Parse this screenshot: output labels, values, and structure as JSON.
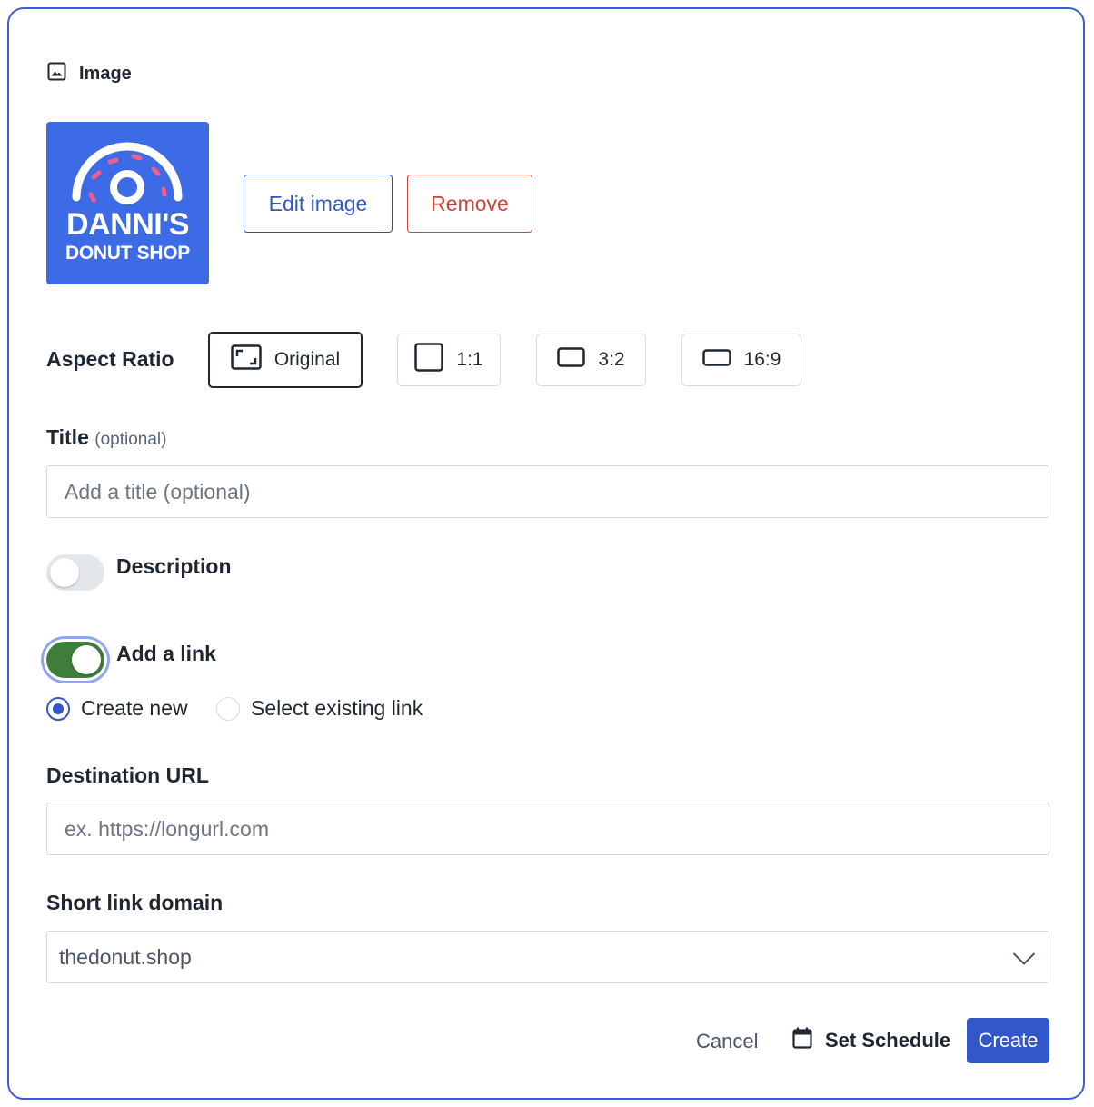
{
  "image_section": {
    "header_label": "Image",
    "header_icon": "image-icon",
    "thumbnail": {
      "logo_line1": "DANNI'S",
      "logo_line2": "DONUT SHOP",
      "bg_color": "#3d6be6"
    },
    "edit_label": "Edit image",
    "remove_label": "Remove"
  },
  "aspect_ratio": {
    "label": "Aspect Ratio",
    "options": [
      {
        "label": "Original",
        "icon": "crop-original-icon",
        "selected": true
      },
      {
        "label": "1:1",
        "icon": "square-icon",
        "selected": false
      },
      {
        "label": "3:2",
        "icon": "rectangle-icon",
        "selected": false
      },
      {
        "label": "16:9",
        "icon": "wide-rectangle-icon",
        "selected": false
      }
    ]
  },
  "title_field": {
    "label": "Title",
    "optional_label": "(optional)",
    "placeholder": "Add a title (optional)",
    "value": ""
  },
  "description_toggle": {
    "label": "Description",
    "on": false
  },
  "link_toggle": {
    "label": "Add a link",
    "on": true,
    "on_color": "#3f7d3a"
  },
  "link_mode": {
    "options": [
      {
        "label": "Create new",
        "selected": true
      },
      {
        "label": "Select existing link",
        "selected": false
      }
    ]
  },
  "destination_url": {
    "label": "Destination URL",
    "placeholder": "ex. https://longurl.com",
    "value": ""
  },
  "short_link_domain": {
    "label": "Short link domain",
    "selected": "thedonut.shop"
  },
  "footer": {
    "cancel_label": "Cancel",
    "schedule_label": "Set Schedule",
    "schedule_icon": "calendar-icon",
    "create_label": "Create"
  },
  "colors": {
    "accent": "#3357c8",
    "danger": "#c8463b",
    "border": "#3b5bdb"
  }
}
